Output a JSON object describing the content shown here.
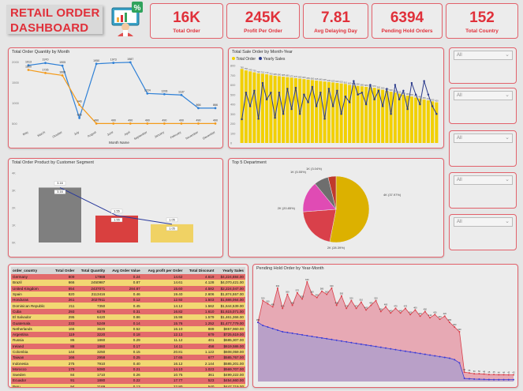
{
  "dashboard": {
    "title_line1": "RETAIL ORDER",
    "title_line2": "DASHBOARD"
  },
  "kpis": [
    {
      "value": "16K",
      "label": "Total Order"
    },
    {
      "value": "245K",
      "label": "Profit Per Order"
    },
    {
      "value": "7.81",
      "label": "Avg Delaying Day"
    },
    {
      "value": "6394",
      "label": "Pending Hold Orders"
    },
    {
      "value": "152",
      "label": "Total Country"
    }
  ],
  "slicers": [
    "All",
    "All",
    "All",
    "All",
    "All"
  ],
  "colors": {
    "accent": "#e0303a",
    "border": "#e2616b",
    "yellow": "#f2d000",
    "navy": "#2a3a8c",
    "grey": "#7f7f7f",
    "red": "#d9403f",
    "pink": "#e04bb4"
  },
  "charts": {
    "qty_month": {
      "title": "Total Order Quantity by Month",
      "xlabel": "Month Name",
      "yticks": [
        "2000",
        "1500",
        "1000",
        "500"
      ]
    },
    "sale_month_year": {
      "title": "Total Sale Order by Month-Year",
      "legend": [
        "Total Order",
        "Yearly Sales"
      ],
      "yticks": [
        "800",
        "700",
        "600",
        "500",
        "400",
        "300",
        "200",
        "100",
        "0"
      ]
    },
    "segment": {
      "title": "Total Order Product by Customer Segment",
      "yticks": [
        "4K",
        "3K",
        "2K",
        "1K",
        "0K"
      ]
    },
    "dept": {
      "title": "Top 5 Department"
    },
    "pending": {
      "title": "Pending Hold Order by Year-Month"
    }
  },
  "chart_data": [
    {
      "type": "line",
      "title": "Total Order Quantity by Month",
      "xlabel": "Month Name",
      "categories": [
        "May",
        "March",
        "October",
        "July",
        "August",
        "June",
        "April",
        "September",
        "January",
        "February",
        "November",
        "December"
      ],
      "series": [
        {
          "name": "blue",
          "values": [
            1913,
            1970,
            1905,
            626,
            1950,
            1973,
            1987,
            1224,
            1206,
            1187,
            866,
            866
          ]
        },
        {
          "name": "orange",
          "values": [
            1800,
            1726,
            1666,
            946,
            490,
            490,
            490,
            490,
            490,
            490,
            490,
            490
          ]
        }
      ],
      "labels_blue": [
        "1913",
        "1970",
        "1905",
        "626",
        "1950",
        "1973",
        "1987",
        "1224",
        "1206",
        "1187",
        "866",
        "866"
      ],
      "labels_orange": [
        "1800",
        "1726",
        "1666",
        "946",
        "490",
        "490",
        "490",
        "490",
        "490",
        "490",
        "490",
        "490"
      ]
    },
    {
      "type": "bar",
      "title": "Total Sale Order by Month-Year",
      "series": [
        {
          "name": "Total Order",
          "values": [
            765,
            750,
            740,
            730,
            720,
            716,
            710,
            700,
            695,
            690,
            685,
            680,
            675,
            670,
            665,
            660,
            655,
            650,
            645,
            640,
            635,
            630,
            625,
            620,
            615,
            610,
            600,
            595,
            590,
            585,
            580,
            575,
            570,
            560,
            550,
            540,
            530,
            520,
            510,
            500,
            490,
            480,
            470,
            460,
            450,
            440,
            430,
            420
          ]
        },
        {
          "name": "Yearly Sales",
          "values": [
            245,
            520,
            380,
            540,
            250,
            620,
            450,
            520,
            260,
            520,
            300,
            560,
            350,
            570,
            300,
            500,
            420,
            580,
            380,
            520,
            250,
            560,
            380,
            540,
            300,
            480,
            420,
            640,
            500,
            520,
            400,
            600,
            450,
            540,
            380,
            560,
            300,
            600,
            450,
            540,
            350,
            620,
            500,
            400,
            640,
            500,
            380,
            300
          ]
        }
      ],
      "yticks": [
        "800",
        "700",
        "600",
        "500",
        "400",
        "300",
        "200",
        "100",
        "0"
      ]
    },
    {
      "type": "bar",
      "title": "Total Order Product by Customer Segment",
      "categories": [
        "Consumer",
        "Corporate",
        "Home Office"
      ],
      "series": [
        {
          "name": "bars",
          "values": [
            3.16,
            1.55,
            1.05
          ]
        },
        {
          "name": "line",
          "values": [
            3.16,
            1.55,
            1.05
          ]
        }
      ],
      "labels": [
        "3.16",
        "1.55",
        "1.05"
      ],
      "ylim": [
        0,
        4
      ]
    },
    {
      "type": "pie",
      "title": "Top 5 Department",
      "series": [
        {
          "values": [
            3.97,
            1.55,
            1.14,
            0.53,
            0.29
          ]
        }
      ],
      "slice_labels": [
        "4K (37.97%)",
        "2K (28.39%)",
        "2K (20.85%)",
        "1K (5.55%)",
        "1K (3.04%)"
      ]
    },
    {
      "type": "area",
      "title": "Pending Hold Order by Year-Month",
      "series": [
        {
          "name": "Pending",
          "values": [
            380,
            520,
            500,
            480,
            600,
            470,
            560,
            490,
            570,
            530,
            640,
            560,
            540,
            580,
            560,
            600,
            490,
            550,
            470,
            520,
            470,
            510,
            460,
            490,
            520,
            450,
            480,
            440,
            470,
            440,
            470,
            430,
            460,
            420,
            450,
            410,
            430,
            400,
            420,
            380,
            350,
            320,
            60,
            55,
            50,
            50,
            48,
            45,
            45,
            44,
            44,
            43,
            43
          ]
        },
        {
          "name": "Hold",
          "values": [
            380,
            360,
            350,
            340,
            330,
            320,
            315,
            310,
            305,
            300,
            295,
            290,
            285,
            280,
            275,
            270,
            265,
            260,
            255,
            250,
            245,
            240,
            235,
            230,
            225,
            220,
            215,
            210,
            205,
            200,
            195,
            190,
            185,
            180,
            175,
            170,
            165,
            160,
            155,
            150,
            140,
            120,
            20,
            18,
            16,
            15,
            14,
            13,
            12,
            12,
            12,
            12,
            12
          ]
        }
      ]
    }
  ],
  "table": {
    "headers": [
      "order_country",
      "Total Order",
      "Total Quantity",
      "Avg Order Value",
      "Avg profit per Order",
      "Total Discount",
      "Yearly Sales"
    ],
    "rows": [
      [
        "Germany",
        "809",
        "17988",
        "0.24",
        "14.62",
        "4.619",
        "$4,224,884.00"
      ],
      [
        "Brazil",
        "666",
        "2450987",
        "0.87",
        "14.61",
        "4.128",
        "$4,070,421.00"
      ],
      [
        "United Kingdom",
        "654",
        "2437071",
        "284.87",
        "15.60",
        "4.582",
        "$2,224,047.00"
      ],
      [
        "Spain",
        "820",
        "2113416",
        "0.46",
        "19.40",
        "2.606",
        "$1,874,557.00"
      ],
      [
        "Honduras",
        "261",
        "2027911",
        "0.12",
        "12.92",
        "1.503",
        "$1,686,064.00"
      ],
      [
        "Dominican Republic",
        "211",
        "7350",
        "0.45",
        "14.12",
        "1.562",
        "$1,644,539.00"
      ],
      [
        "Cuba",
        "293",
        "6379",
        "0.31",
        "16.82",
        "1.610",
        "$1,615,071.00"
      ],
      [
        "El Salvador",
        "295",
        "6420",
        "0.86",
        "15.98",
        "1.579",
        "$1,461,366.00"
      ],
      [
        "Guatemala",
        "233",
        "5249",
        "0.14",
        "15.76",
        "1.252",
        "$1,477,779.00"
      ],
      [
        "Netherlands",
        "166",
        "3620",
        "0.52",
        "16.10",
        "889",
        "$857,960.00"
      ],
      [
        "Argentina",
        "119",
        "3220",
        "0.18",
        "12.13",
        "679",
        "$725,619.00"
      ],
      [
        "Russia",
        "86",
        "1860",
        "0.29",
        "11.12",
        "401",
        "$685,307.00"
      ],
      [
        "Ireland",
        "88",
        "1860",
        "0.17",
        "14.11",
        "458",
        "$619,586.00"
      ],
      [
        "Colombia",
        "144",
        "3250",
        "0.15",
        "20.81",
        "1.122",
        "$608,059.00"
      ],
      [
        "Taiwan",
        "166",
        "2958",
        "0.25",
        "17.65",
        "677",
        "$585,767.00"
      ],
      [
        "Indonesia",
        "275",
        "7910",
        "0.40",
        "16.12",
        "2.144",
        "$585,201.00"
      ],
      [
        "Morocco",
        "179",
        "5080",
        "0.21",
        "14.10",
        "1.023",
        "$569,707.00"
      ],
      [
        "Sweden",
        "84",
        "1710",
        "0.26",
        "10.75",
        "361",
        "$499,222.00"
      ],
      [
        "Ecuador",
        "91",
        "1880",
        "0.22",
        "17.77",
        "523",
        "$454,660.00"
      ],
      [
        "Peru",
        "94",
        "2169",
        "0.13",
        "22.80",
        "540",
        "$447,719.00"
      ]
    ],
    "total": [
      "Total",
      "15616",
      "100098134",
      "168.41",
      "15.82",
      "86.708",
      "$2,775,512.00"
    ]
  }
}
